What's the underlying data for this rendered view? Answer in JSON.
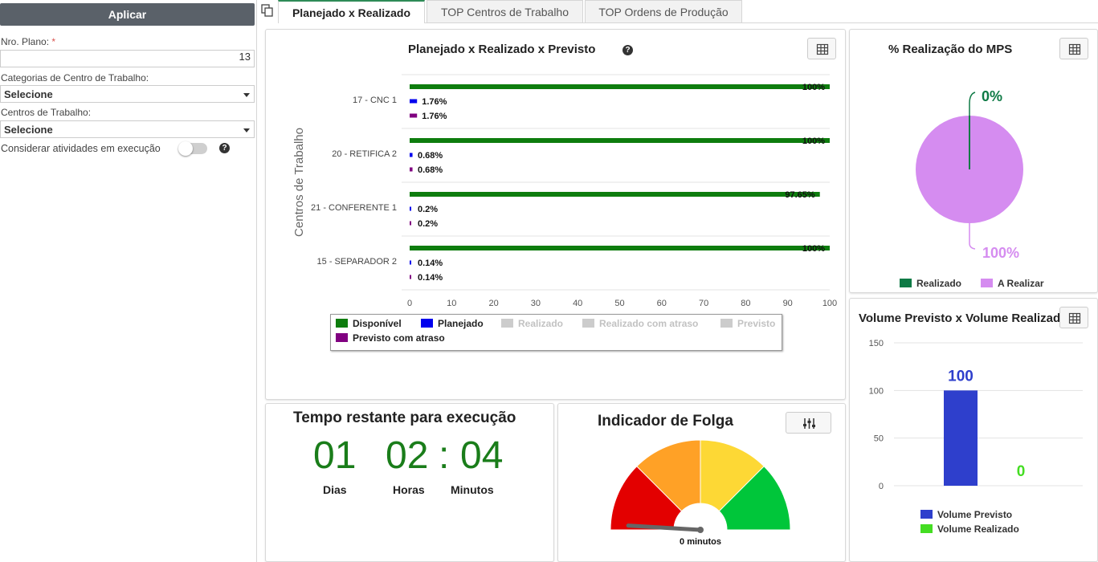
{
  "filters": {
    "apply_label": "Aplicar",
    "plan_label": "Nro. Plano:",
    "plan_required_mark": "*",
    "plan_value": "13",
    "category_label": "Categorias de Centro de Trabalho:",
    "category_value": "Selecione",
    "centers_label": "Centros de Trabalho:",
    "centers_value": "Selecione",
    "consider_label": "Considerar atividades em execução",
    "consider_on": false,
    "help_glyph": "?"
  },
  "tabs": [
    {
      "label": "Planejado x Realizado",
      "active": true
    },
    {
      "label": "TOP Centros de Trabalho",
      "active": false
    },
    {
      "label": "TOP Ordens de Produção",
      "active": false
    }
  ],
  "pvr_chart": {
    "title": "Planejado x Realizado x Previsto",
    "y_axis_label": "Centros de Trabalho",
    "chart_data": {
      "type": "bar",
      "orientation": "horizontal",
      "categories": [
        "17 - CNC 1",
        "20 - RETIFICA 2",
        "21 - CONFERENTE 1",
        "15 - SEPARADOR 2"
      ],
      "series": [
        {
          "name": "Disponível",
          "color": "#0e7d0e",
          "values": [
            100,
            100,
            97.65,
            100
          ],
          "labels": [
            "100%",
            "100%",
            "97.65%",
            "100%"
          ]
        },
        {
          "name": "Planejado",
          "color": "#0000ee",
          "values": [
            1.76,
            0.68,
            0.2,
            0.14
          ],
          "labels": [
            "1.76%",
            "0.68%",
            "0.2%",
            "0.14%"
          ]
        },
        {
          "name": "Previsto com atraso",
          "color": "#800080",
          "values": [
            1.76,
            0.68,
            0.2,
            0.14
          ],
          "labels": [
            "1.76%",
            "0.68%",
            "0.2%",
            "0.14%"
          ]
        }
      ],
      "xlim": [
        0,
        100
      ],
      "x_ticks": [
        "0",
        "10",
        "20",
        "30",
        "40",
        "50",
        "60",
        "70",
        "80",
        "90",
        "100"
      ],
      "legend": [
        {
          "name": "Disponível",
          "color": "#0e7d0e",
          "enabled": true
        },
        {
          "name": "Planejado",
          "color": "#0000ee",
          "enabled": true
        },
        {
          "name": "Realizado",
          "color": "#cccccc",
          "enabled": false
        },
        {
          "name": "Realizado com atraso",
          "color": "#cccccc",
          "enabled": false
        },
        {
          "name": "Previsto",
          "color": "#cccccc",
          "enabled": false
        },
        {
          "name": "Previsto com atraso",
          "color": "#800080",
          "enabled": true
        }
      ],
      "legend_placement": "bottom"
    }
  },
  "mps": {
    "title": "% Realização do MPS",
    "chart_data": {
      "type": "pie",
      "slices": [
        {
          "name": "Realizado",
          "value": 0,
          "label": "0%",
          "color": "#0e7a45"
        },
        {
          "name": "A Realizar",
          "value": 100,
          "label": "100%",
          "color": "#d58cf0"
        }
      ],
      "legend_placement": "bottom"
    }
  },
  "volume": {
    "title": "Volume Previsto x Volume Realizado",
    "chart_data": {
      "type": "bar",
      "categories": [
        "Volume Previsto",
        "Volume Realizado"
      ],
      "series": [
        {
          "name": "Volume Previsto",
          "color": "#2e3fcc",
          "values": [
            100
          ],
          "label": "100"
        },
        {
          "name": "Volume Realizado",
          "color": "#44dd22",
          "values": [
            0
          ],
          "label": "0"
        }
      ],
      "ylim": [
        0,
        150
      ],
      "y_ticks": [
        "0",
        "50",
        "100",
        "150"
      ],
      "legend_placement": "bottom"
    }
  },
  "time_remaining": {
    "title": "Tempo restante para execução",
    "days": "01",
    "hours": "02",
    "separator": ":",
    "minutes": "04",
    "days_label": "Dias",
    "hours_label": "Horas",
    "minutes_label": "Minutos"
  },
  "slack": {
    "title": "Indicador de Folga",
    "value_label": "0 minutos",
    "gauge_value": 0,
    "gauge_colors": [
      "#e30000",
      "#ffa126",
      "#fdd835",
      "#00c63a"
    ]
  }
}
